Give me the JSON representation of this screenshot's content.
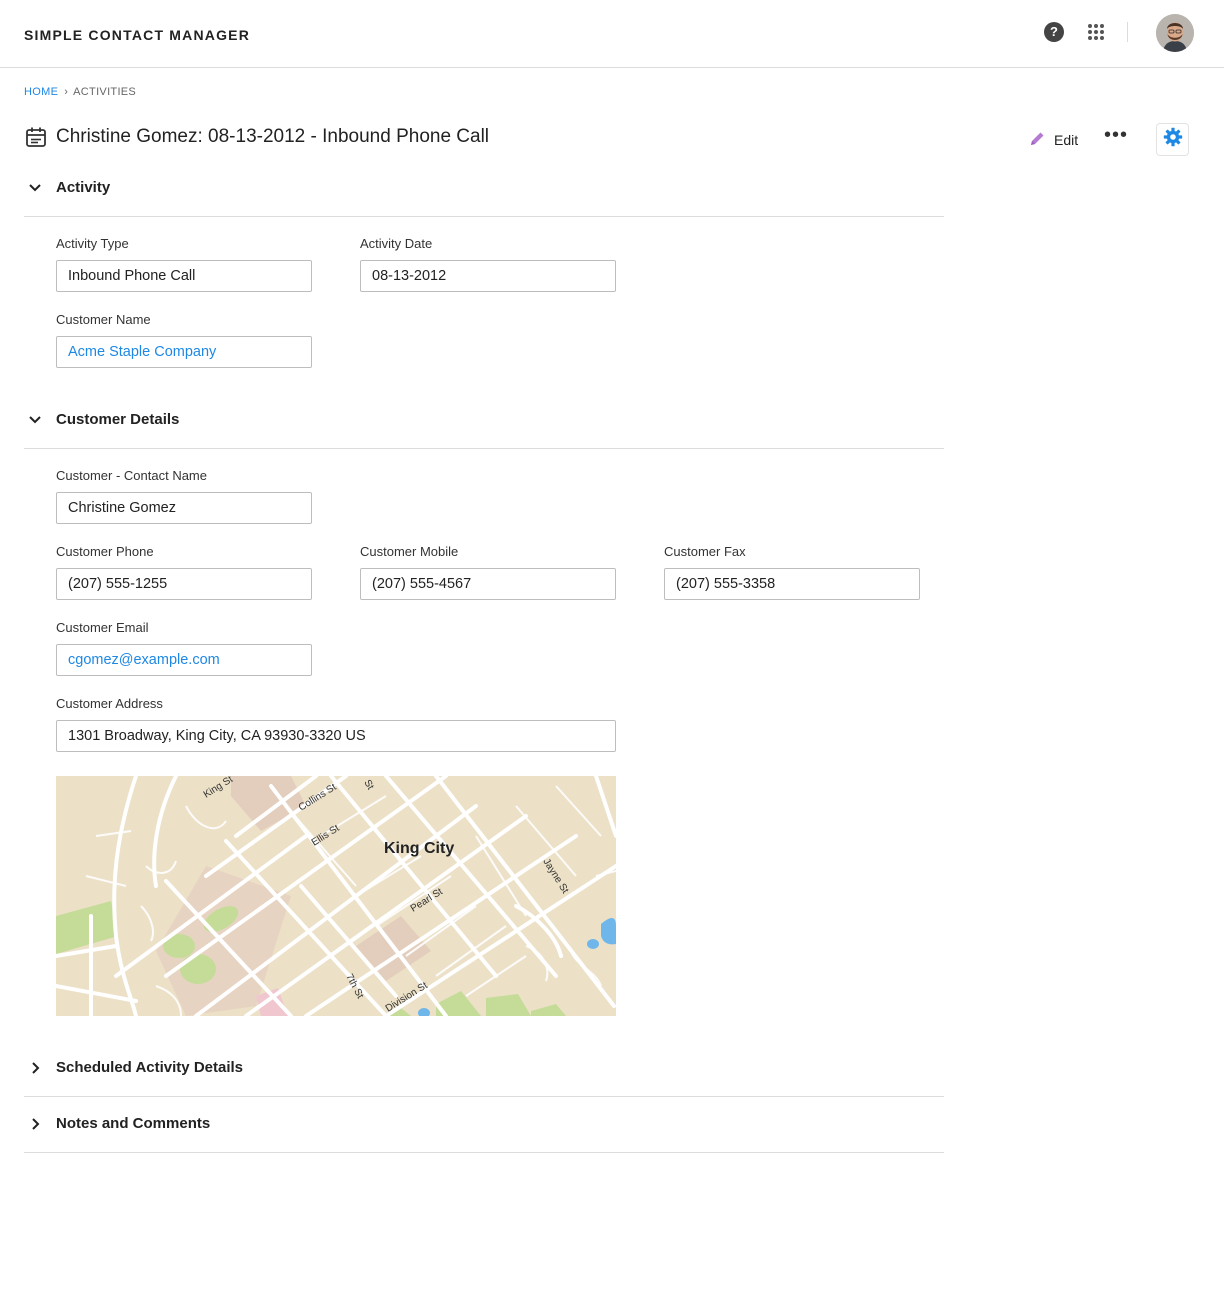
{
  "app": {
    "title": "SIMPLE CONTACT MANAGER"
  },
  "topbar": {
    "help_icon": "help-circle-icon",
    "apps_icon": "app-launcher-grid-icon",
    "avatar": "user-avatar-photo"
  },
  "breadcrumb": {
    "home": "HOME",
    "current": "ACTIVITIES"
  },
  "page": {
    "title": "Christine Gomez: 08-13-2012 - Inbound Phone Call",
    "record_icon": "calendar-record-icon"
  },
  "actions": {
    "edit_label": "Edit",
    "more_label": "•••",
    "settings_icon": "gear-icon"
  },
  "sections": {
    "activity": {
      "label": "Activity",
      "fields": {
        "activity_type": {
          "label": "Activity Type",
          "value": "Inbound Phone Call"
        },
        "activity_date": {
          "label": "Activity Date",
          "value": "08-13-2012"
        },
        "customer_name": {
          "label": "Customer Name",
          "value": "Acme Staple Company"
        }
      }
    },
    "customer_details": {
      "label": "Customer Details",
      "fields": {
        "contact_name": {
          "label": "Customer - Contact Name",
          "value": "Christine Gomez"
        },
        "phone": {
          "label": "Customer Phone",
          "value": "(207) 555-1255"
        },
        "mobile": {
          "label": "Customer Mobile",
          "value": "(207) 555-4567"
        },
        "fax": {
          "label": "Customer Fax",
          "value": "(207) 555-3358"
        },
        "email": {
          "label": "Customer Email",
          "value": "cgomez@example.com"
        },
        "address": {
          "label": "Customer Address",
          "value": "1301 Broadway, King City, CA 93930-3320 US"
        }
      },
      "map": {
        "city_label": "King City",
        "street_labels": [
          "King St",
          "Collins St",
          "Ellis St",
          "St",
          "Jayne St",
          "Pearl St",
          "7th St",
          "Division St"
        ]
      }
    },
    "scheduled": {
      "label": "Scheduled Activity Details"
    },
    "notes": {
      "label": "Notes and Comments"
    }
  },
  "colors": {
    "accent": "#1e88e5",
    "edit_icon": "#b57bd4",
    "map_land": "#ece0c7",
    "map_park": "#c5dc98",
    "map_water": "#6fb6ea"
  }
}
